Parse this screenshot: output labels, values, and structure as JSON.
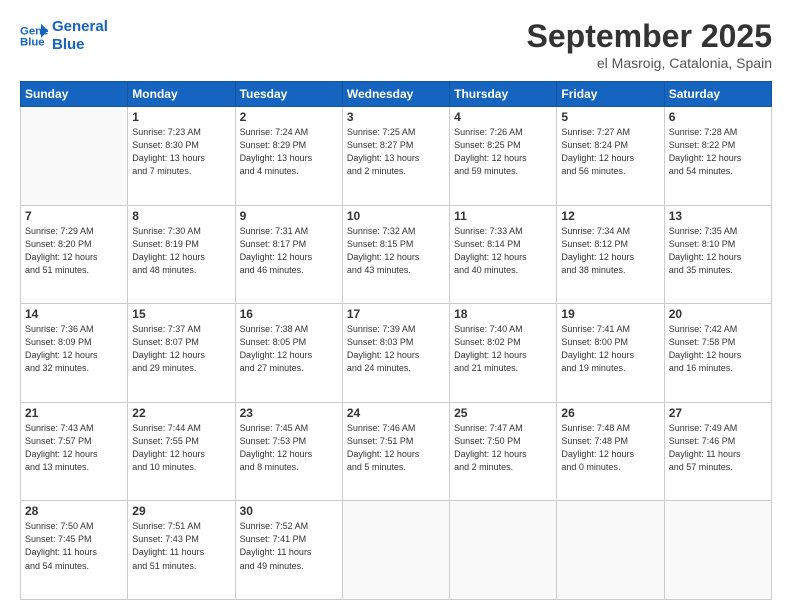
{
  "logo": {
    "line1": "General",
    "line2": "Blue"
  },
  "title": "September 2025",
  "location": "el Masroig, Catalonia, Spain",
  "days_of_week": [
    "Sunday",
    "Monday",
    "Tuesday",
    "Wednesday",
    "Thursday",
    "Friday",
    "Saturday"
  ],
  "weeks": [
    [
      {
        "day": "",
        "info": ""
      },
      {
        "day": "1",
        "info": "Sunrise: 7:23 AM\nSunset: 8:30 PM\nDaylight: 13 hours\nand 7 minutes."
      },
      {
        "day": "2",
        "info": "Sunrise: 7:24 AM\nSunset: 8:29 PM\nDaylight: 13 hours\nand 4 minutes."
      },
      {
        "day": "3",
        "info": "Sunrise: 7:25 AM\nSunset: 8:27 PM\nDaylight: 13 hours\nand 2 minutes."
      },
      {
        "day": "4",
        "info": "Sunrise: 7:26 AM\nSunset: 8:25 PM\nDaylight: 12 hours\nand 59 minutes."
      },
      {
        "day": "5",
        "info": "Sunrise: 7:27 AM\nSunset: 8:24 PM\nDaylight: 12 hours\nand 56 minutes."
      },
      {
        "day": "6",
        "info": "Sunrise: 7:28 AM\nSunset: 8:22 PM\nDaylight: 12 hours\nand 54 minutes."
      }
    ],
    [
      {
        "day": "7",
        "info": "Sunrise: 7:29 AM\nSunset: 8:20 PM\nDaylight: 12 hours\nand 51 minutes."
      },
      {
        "day": "8",
        "info": "Sunrise: 7:30 AM\nSunset: 8:19 PM\nDaylight: 12 hours\nand 48 minutes."
      },
      {
        "day": "9",
        "info": "Sunrise: 7:31 AM\nSunset: 8:17 PM\nDaylight: 12 hours\nand 46 minutes."
      },
      {
        "day": "10",
        "info": "Sunrise: 7:32 AM\nSunset: 8:15 PM\nDaylight: 12 hours\nand 43 minutes."
      },
      {
        "day": "11",
        "info": "Sunrise: 7:33 AM\nSunset: 8:14 PM\nDaylight: 12 hours\nand 40 minutes."
      },
      {
        "day": "12",
        "info": "Sunrise: 7:34 AM\nSunset: 8:12 PM\nDaylight: 12 hours\nand 38 minutes."
      },
      {
        "day": "13",
        "info": "Sunrise: 7:35 AM\nSunset: 8:10 PM\nDaylight: 12 hours\nand 35 minutes."
      }
    ],
    [
      {
        "day": "14",
        "info": "Sunrise: 7:36 AM\nSunset: 8:09 PM\nDaylight: 12 hours\nand 32 minutes."
      },
      {
        "day": "15",
        "info": "Sunrise: 7:37 AM\nSunset: 8:07 PM\nDaylight: 12 hours\nand 29 minutes."
      },
      {
        "day": "16",
        "info": "Sunrise: 7:38 AM\nSunset: 8:05 PM\nDaylight: 12 hours\nand 27 minutes."
      },
      {
        "day": "17",
        "info": "Sunrise: 7:39 AM\nSunset: 8:03 PM\nDaylight: 12 hours\nand 24 minutes."
      },
      {
        "day": "18",
        "info": "Sunrise: 7:40 AM\nSunset: 8:02 PM\nDaylight: 12 hours\nand 21 minutes."
      },
      {
        "day": "19",
        "info": "Sunrise: 7:41 AM\nSunset: 8:00 PM\nDaylight: 12 hours\nand 19 minutes."
      },
      {
        "day": "20",
        "info": "Sunrise: 7:42 AM\nSunset: 7:58 PM\nDaylight: 12 hours\nand 16 minutes."
      }
    ],
    [
      {
        "day": "21",
        "info": "Sunrise: 7:43 AM\nSunset: 7:57 PM\nDaylight: 12 hours\nand 13 minutes."
      },
      {
        "day": "22",
        "info": "Sunrise: 7:44 AM\nSunset: 7:55 PM\nDaylight: 12 hours\nand 10 minutes."
      },
      {
        "day": "23",
        "info": "Sunrise: 7:45 AM\nSunset: 7:53 PM\nDaylight: 12 hours\nand 8 minutes."
      },
      {
        "day": "24",
        "info": "Sunrise: 7:46 AM\nSunset: 7:51 PM\nDaylight: 12 hours\nand 5 minutes."
      },
      {
        "day": "25",
        "info": "Sunrise: 7:47 AM\nSunset: 7:50 PM\nDaylight: 12 hours\nand 2 minutes."
      },
      {
        "day": "26",
        "info": "Sunrise: 7:48 AM\nSunset: 7:48 PM\nDaylight: 12 hours\nand 0 minutes."
      },
      {
        "day": "27",
        "info": "Sunrise: 7:49 AM\nSunset: 7:46 PM\nDaylight: 11 hours\nand 57 minutes."
      }
    ],
    [
      {
        "day": "28",
        "info": "Sunrise: 7:50 AM\nSunset: 7:45 PM\nDaylight: 11 hours\nand 54 minutes."
      },
      {
        "day": "29",
        "info": "Sunrise: 7:51 AM\nSunset: 7:43 PM\nDaylight: 11 hours\nand 51 minutes."
      },
      {
        "day": "30",
        "info": "Sunrise: 7:52 AM\nSunset: 7:41 PM\nDaylight: 11 hours\nand 49 minutes."
      },
      {
        "day": "",
        "info": ""
      },
      {
        "day": "",
        "info": ""
      },
      {
        "day": "",
        "info": ""
      },
      {
        "day": "",
        "info": ""
      }
    ]
  ]
}
